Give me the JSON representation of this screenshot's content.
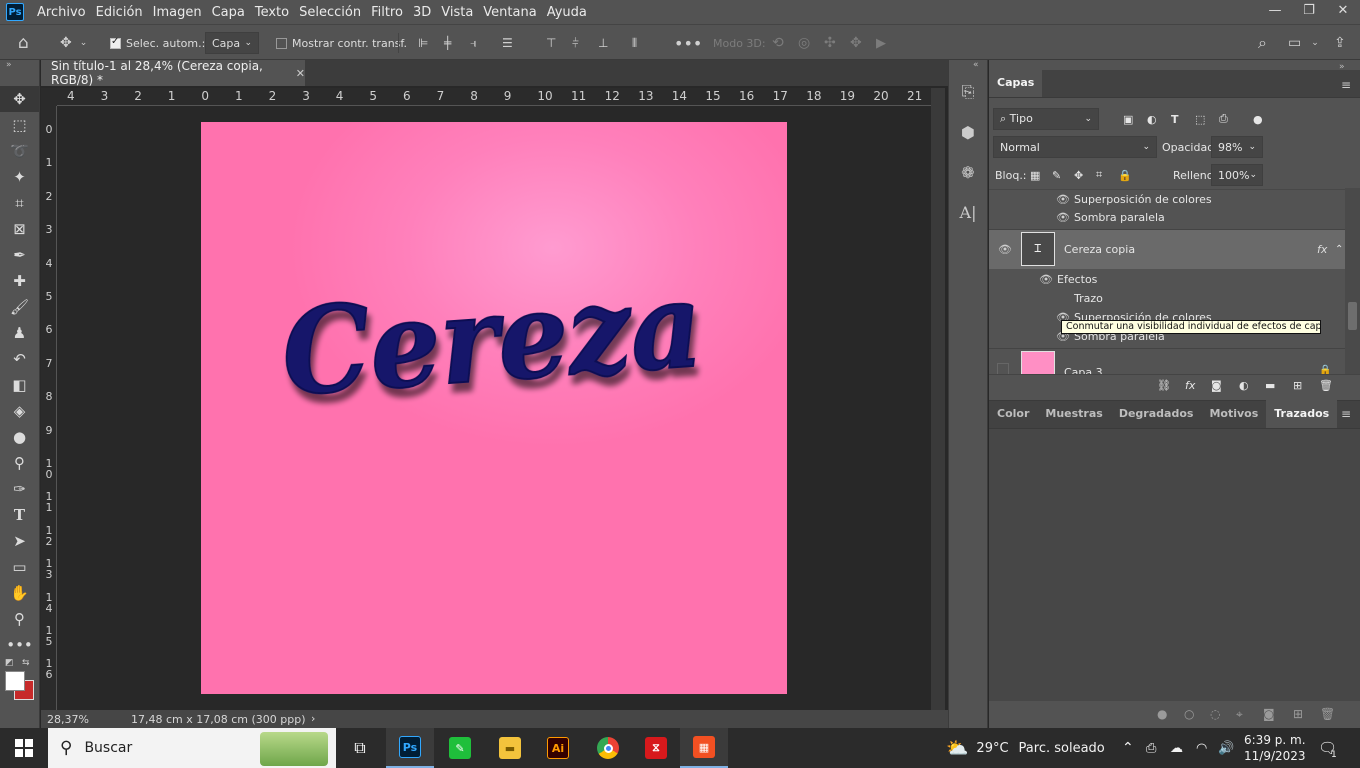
{
  "menubar": {
    "items": [
      "Archivo",
      "Edición",
      "Imagen",
      "Capa",
      "Texto",
      "Selección",
      "Filtro",
      "3D",
      "Vista",
      "Ventana",
      "Ayuda"
    ],
    "logo": "Ps"
  },
  "options": {
    "auto_select_label": "Selec. autom.:",
    "auto_select_value": "Capa",
    "show_transform_label": "Mostrar contr. transf.",
    "mode3d_label": "Modo 3D:"
  },
  "document": {
    "tab_title": "Sin título-1 al 28,4% (Cereza copia, RGB/8) *",
    "canvas_text": "Cereza",
    "canvas_color": "#ff7eb8",
    "text_color": "#14176b"
  },
  "ruler": {
    "h": [
      "4",
      "3",
      "2",
      "1",
      "0",
      "1",
      "2",
      "3",
      "4",
      "5",
      "6",
      "7",
      "8",
      "9",
      "10",
      "11",
      "12",
      "13",
      "14",
      "15",
      "16",
      "17",
      "18",
      "19",
      "20",
      "21"
    ],
    "v": [
      "0",
      "1",
      "2",
      "3",
      "4",
      "5",
      "6",
      "7",
      "8",
      "9",
      "1 0",
      "1 1",
      "1 2",
      "1 3",
      "1 4",
      "1 5",
      "1 6"
    ]
  },
  "status": {
    "zoom": "28,37%",
    "doc_size": "17,48 cm x 17,08 cm (300 ppp)"
  },
  "layers_panel": {
    "tab": "Capas",
    "filter_label": "Tipo",
    "blend_mode": "Normal",
    "opacity_label": "Opacidad:",
    "opacity_value": "98%",
    "lock_label": "Bloq.:",
    "fill_label": "Relleno:",
    "fill_value": "100%",
    "rows": {
      "prev_effect1": "Superposición de colores",
      "prev_effect2": "Sombra paralela",
      "layer_name": "Cereza copia",
      "fx": "fx",
      "effects": "Efectos",
      "effect_stroke": "Trazo",
      "effect_overlay": "Superposición de colores",
      "effect_shadow": "Sombra paralela",
      "layer3": "Capa 3"
    },
    "tooltip": "Conmutar una visibilidad individual de efectos de capa"
  },
  "lower_panel": {
    "tabs": [
      "Color",
      "Muestras",
      "Degradados",
      "Motivos",
      "Trazados"
    ],
    "active_tab": "Trazados"
  },
  "taskbar": {
    "search_placeholder": "Buscar",
    "weather_temp": "29°C",
    "weather_text": "Parc. soleado",
    "time": "6:39 p. m.",
    "date": "11/9/2023",
    "notif_count": "1"
  }
}
